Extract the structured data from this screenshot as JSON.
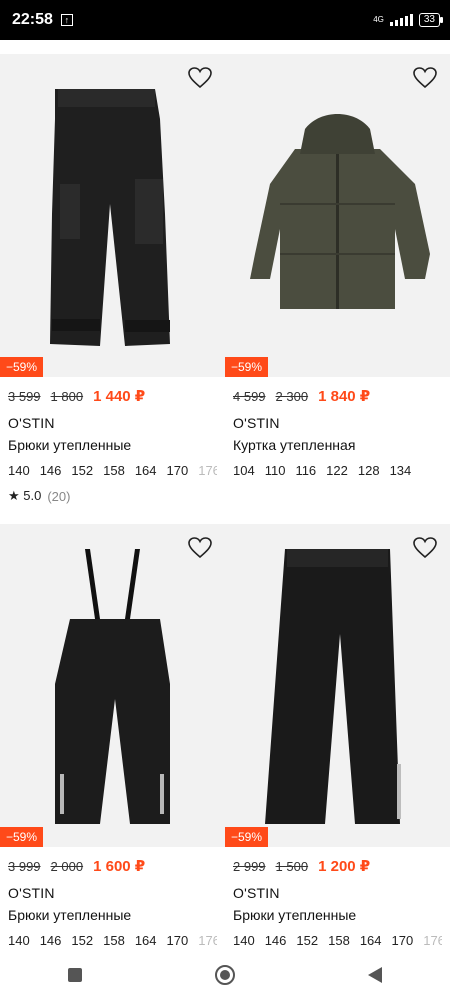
{
  "status_bar": {
    "time": "22:58",
    "network": "4G",
    "battery": "33"
  },
  "products": [
    {
      "badge": "−59%",
      "prices": [
        "3 599",
        "1 800",
        "1 440 ₽"
      ],
      "brand": "O'STIN",
      "title": "Брюки утепленные",
      "sizes": [
        "140",
        "146",
        "152",
        "158",
        "164",
        "170",
        "176"
      ],
      "rating": {
        "value": "★ 5.0",
        "count": "(20)"
      },
      "image": "black-cargo-pants"
    },
    {
      "badge": "−59%",
      "prices": [
        "4 599",
        "2 300",
        "1 840 ₽"
      ],
      "brand": "O'STIN",
      "title": "Куртка утепленная",
      "sizes": [
        "104",
        "110",
        "116",
        "122",
        "128",
        "134"
      ],
      "image": "olive-puffer-jacket"
    },
    {
      "badge": "−59%",
      "prices": [
        "3 999",
        "2 000",
        "1 600 ₽"
      ],
      "brand": "O'STIN",
      "title": "Брюки утепленные",
      "sizes": [
        "140",
        "146",
        "152",
        "158",
        "164",
        "170",
        "176"
      ],
      "image": "black-overalls"
    },
    {
      "badge": "−59%",
      "prices": [
        "2 999",
        "1 500",
        "1 200 ₽"
      ],
      "brand": "O'STIN",
      "title": "Брюки утепленные",
      "sizes": [
        "140",
        "146",
        "152",
        "158",
        "164",
        "170",
        "176"
      ],
      "image": "black-pants"
    }
  ],
  "colors": {
    "accent": "#ff4a19",
    "image_bg": "#f2f2f2"
  },
  "nav": {
    "icons": [
      "square-icon",
      "home-circle-icon",
      "back-triangle-icon"
    ]
  }
}
